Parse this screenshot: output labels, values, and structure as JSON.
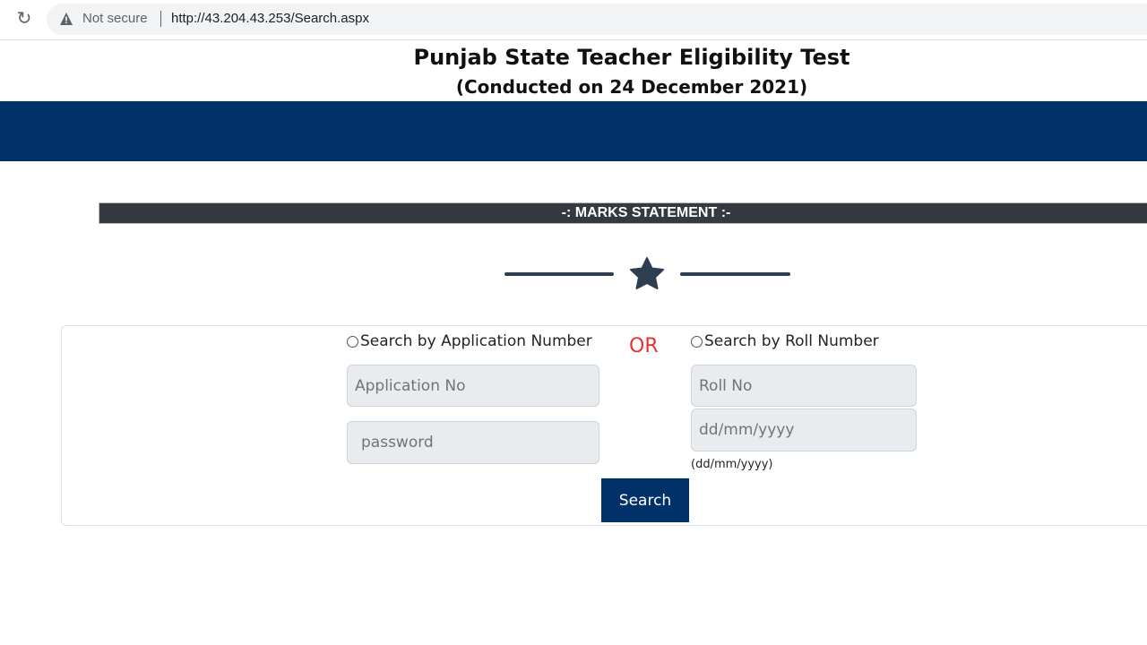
{
  "browser": {
    "reload_icon": "reload-icon",
    "warning_icon": "warning-triangle-icon",
    "security_label": "Not secure",
    "url": "http://43.204.43.253/Search.aspx"
  },
  "header": {
    "title": "Punjab State Teacher Eligibility Test",
    "subtitle": "(Conducted on 24 December 2021)"
  },
  "section": {
    "heading": "-: MARKS STATEMENT :-",
    "divider_icon": "star-icon"
  },
  "form": {
    "option_application": "Search by Application Number",
    "or_label": "OR",
    "option_roll": "Search by Roll Number",
    "application_no_placeholder": "Application No",
    "password_placeholder": "password",
    "roll_no_placeholder": "Roll No",
    "dob_placeholder": "dd/mm/yyyy",
    "dob_hint": "(dd/mm/yyyy)",
    "search_button": "Search"
  },
  "colors": {
    "brand_blue": "#003169",
    "heading_bar": "#343a40",
    "or_red": "#e8312f"
  }
}
